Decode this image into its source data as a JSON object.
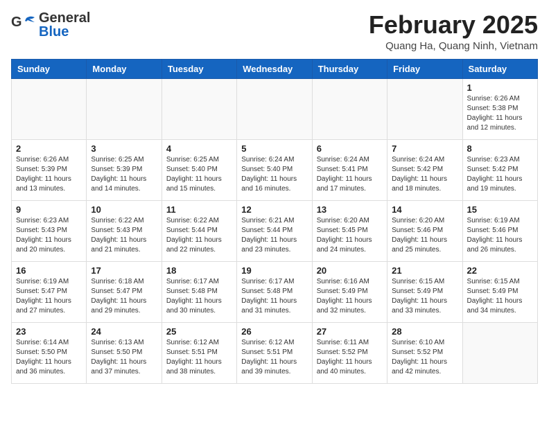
{
  "header": {
    "logo_line1": "General",
    "logo_line2": "Blue",
    "month_year": "February 2025",
    "location": "Quang Ha, Quang Ninh, Vietnam"
  },
  "weekdays": [
    "Sunday",
    "Monday",
    "Tuesday",
    "Wednesday",
    "Thursday",
    "Friday",
    "Saturday"
  ],
  "weeks": [
    [
      {
        "day": "",
        "info": ""
      },
      {
        "day": "",
        "info": ""
      },
      {
        "day": "",
        "info": ""
      },
      {
        "day": "",
        "info": ""
      },
      {
        "day": "",
        "info": ""
      },
      {
        "day": "",
        "info": ""
      },
      {
        "day": "1",
        "info": "Sunrise: 6:26 AM\nSunset: 5:38 PM\nDaylight: 11 hours\nand 12 minutes."
      }
    ],
    [
      {
        "day": "2",
        "info": "Sunrise: 6:26 AM\nSunset: 5:39 PM\nDaylight: 11 hours\nand 13 minutes."
      },
      {
        "day": "3",
        "info": "Sunrise: 6:25 AM\nSunset: 5:39 PM\nDaylight: 11 hours\nand 14 minutes."
      },
      {
        "day": "4",
        "info": "Sunrise: 6:25 AM\nSunset: 5:40 PM\nDaylight: 11 hours\nand 15 minutes."
      },
      {
        "day": "5",
        "info": "Sunrise: 6:24 AM\nSunset: 5:40 PM\nDaylight: 11 hours\nand 16 minutes."
      },
      {
        "day": "6",
        "info": "Sunrise: 6:24 AM\nSunset: 5:41 PM\nDaylight: 11 hours\nand 17 minutes."
      },
      {
        "day": "7",
        "info": "Sunrise: 6:24 AM\nSunset: 5:42 PM\nDaylight: 11 hours\nand 18 minutes."
      },
      {
        "day": "8",
        "info": "Sunrise: 6:23 AM\nSunset: 5:42 PM\nDaylight: 11 hours\nand 19 minutes."
      }
    ],
    [
      {
        "day": "9",
        "info": "Sunrise: 6:23 AM\nSunset: 5:43 PM\nDaylight: 11 hours\nand 20 minutes."
      },
      {
        "day": "10",
        "info": "Sunrise: 6:22 AM\nSunset: 5:43 PM\nDaylight: 11 hours\nand 21 minutes."
      },
      {
        "day": "11",
        "info": "Sunrise: 6:22 AM\nSunset: 5:44 PM\nDaylight: 11 hours\nand 22 minutes."
      },
      {
        "day": "12",
        "info": "Sunrise: 6:21 AM\nSunset: 5:44 PM\nDaylight: 11 hours\nand 23 minutes."
      },
      {
        "day": "13",
        "info": "Sunrise: 6:20 AM\nSunset: 5:45 PM\nDaylight: 11 hours\nand 24 minutes."
      },
      {
        "day": "14",
        "info": "Sunrise: 6:20 AM\nSunset: 5:46 PM\nDaylight: 11 hours\nand 25 minutes."
      },
      {
        "day": "15",
        "info": "Sunrise: 6:19 AM\nSunset: 5:46 PM\nDaylight: 11 hours\nand 26 minutes."
      }
    ],
    [
      {
        "day": "16",
        "info": "Sunrise: 6:19 AM\nSunset: 5:47 PM\nDaylight: 11 hours\nand 27 minutes."
      },
      {
        "day": "17",
        "info": "Sunrise: 6:18 AM\nSunset: 5:47 PM\nDaylight: 11 hours\nand 29 minutes."
      },
      {
        "day": "18",
        "info": "Sunrise: 6:17 AM\nSunset: 5:48 PM\nDaylight: 11 hours\nand 30 minutes."
      },
      {
        "day": "19",
        "info": "Sunrise: 6:17 AM\nSunset: 5:48 PM\nDaylight: 11 hours\nand 31 minutes."
      },
      {
        "day": "20",
        "info": "Sunrise: 6:16 AM\nSunset: 5:49 PM\nDaylight: 11 hours\nand 32 minutes."
      },
      {
        "day": "21",
        "info": "Sunrise: 6:15 AM\nSunset: 5:49 PM\nDaylight: 11 hours\nand 33 minutes."
      },
      {
        "day": "22",
        "info": "Sunrise: 6:15 AM\nSunset: 5:49 PM\nDaylight: 11 hours\nand 34 minutes."
      }
    ],
    [
      {
        "day": "23",
        "info": "Sunrise: 6:14 AM\nSunset: 5:50 PM\nDaylight: 11 hours\nand 36 minutes."
      },
      {
        "day": "24",
        "info": "Sunrise: 6:13 AM\nSunset: 5:50 PM\nDaylight: 11 hours\nand 37 minutes."
      },
      {
        "day": "25",
        "info": "Sunrise: 6:12 AM\nSunset: 5:51 PM\nDaylight: 11 hours\nand 38 minutes."
      },
      {
        "day": "26",
        "info": "Sunrise: 6:12 AM\nSunset: 5:51 PM\nDaylight: 11 hours\nand 39 minutes."
      },
      {
        "day": "27",
        "info": "Sunrise: 6:11 AM\nSunset: 5:52 PM\nDaylight: 11 hours\nand 40 minutes."
      },
      {
        "day": "28",
        "info": "Sunrise: 6:10 AM\nSunset: 5:52 PM\nDaylight: 11 hours\nand 42 minutes."
      },
      {
        "day": "",
        "info": ""
      }
    ]
  ]
}
